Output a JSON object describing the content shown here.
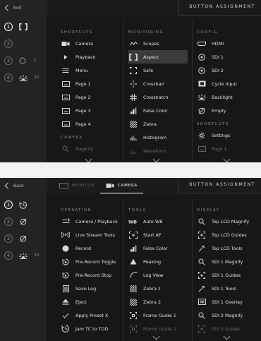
{
  "panel1": {
    "back_label": "Exit",
    "title": "BUTTON ASSIGNMENT",
    "slots": [
      {
        "number": "1",
        "label": "",
        "icon": "aspect-bracket-icon",
        "active": true
      },
      {
        "number": "2",
        "label": "",
        "icon": "",
        "active": false
      },
      {
        "number": "3",
        "label": "1",
        "icon": "lens-1-icon",
        "active": false
      },
      {
        "number": "4",
        "label": "20",
        "icon": "backlight-icon",
        "active": false
      }
    ],
    "columns": [
      {
        "sections": [
          {
            "title": "SHORTCUTS",
            "items": [
              {
                "label": "Camera",
                "icon": "camera-icon"
              },
              {
                "label": "Playback",
                "icon": "play-icon"
              },
              {
                "label": "Menu",
                "icon": "menu-icon"
              },
              {
                "label": "Page 1",
                "icon": "page-icon"
              },
              {
                "label": "Page 2",
                "icon": "page-icon"
              },
              {
                "label": "Page 3",
                "icon": "page-icon"
              },
              {
                "label": "Page 4",
                "icon": "page-icon"
              }
            ]
          },
          {
            "title": "CAMERA",
            "items": [
              {
                "label": "Magnify",
                "icon": "magnify-icon",
                "dim": true
              }
            ]
          }
        ]
      },
      {
        "sections": [
          {
            "title": "MONITORING",
            "items": [
              {
                "label": "Scopes",
                "icon": "scopes-icon"
              },
              {
                "label": "Aspect",
                "icon": "aspect-bracket-icon",
                "selected": true
              },
              {
                "label": "Safe",
                "icon": "safe-icon"
              },
              {
                "label": "Crosshair",
                "icon": "crosshair-icon"
              },
              {
                "label": "Crosshatch",
                "icon": "crosshatch-icon"
              },
              {
                "label": "False Color",
                "icon": "false-color-icon"
              },
              {
                "label": "Zebra",
                "icon": "zebra-icon"
              },
              {
                "label": "Histogram",
                "icon": "histogram-icon"
              },
              {
                "label": "Waveform",
                "icon": "waveform-icon",
                "dim": true
              }
            ]
          }
        ]
      },
      {
        "sections": [
          {
            "title": "CONFIG",
            "items": [
              {
                "label": "HDMI",
                "icon": "hdmi-icon"
              },
              {
                "label": "SDI 1",
                "icon": "sdi-icon"
              },
              {
                "label": "SDI 2",
                "icon": "sdi-icon"
              },
              {
                "label": "Cycle Input",
                "icon": "cycle-input-icon"
              },
              {
                "label": "Backlight",
                "icon": "backlight-icon"
              },
              {
                "label": "Empty",
                "icon": "empty-icon"
              }
            ]
          },
          {
            "title": "SHORTCUTS",
            "items": [
              {
                "label": "Settings",
                "icon": "gear-icon"
              },
              {
                "label": "Page 1",
                "icon": "page-icon",
                "dim": true
              }
            ]
          }
        ]
      }
    ]
  },
  "panel2": {
    "back_label": "Back",
    "title": "BUTTON ASSIGNMENT",
    "tabs": [
      {
        "label": "MONITOR",
        "icon": "monitor-icon",
        "active": false
      },
      {
        "label": "CAMERA",
        "icon": "camera-icon",
        "active": true
      }
    ],
    "slots": [
      {
        "number": "1",
        "label": "",
        "icon": "timecode-sync-icon",
        "active": true
      },
      {
        "number": "2",
        "label": "",
        "icon": "empty-icon",
        "active": false
      },
      {
        "number": "3",
        "label": "",
        "icon": "empty-icon",
        "active": false
      },
      {
        "number": "4",
        "label": "20",
        "icon": "backlight-icon",
        "active": false
      }
    ],
    "columns": [
      {
        "sections": [
          {
            "title": "OPERATION",
            "items": [
              {
                "label": "Camera / Playback",
                "icon": "camera-playback-icon"
              },
              {
                "label": "Live Stream Tools",
                "icon": "live-stream-icon"
              },
              {
                "label": "Record",
                "icon": "record-icon"
              },
              {
                "label": "Pre-Record Toggle",
                "icon": "pre-record-icon"
              },
              {
                "label": "Pre-Record Stop",
                "icon": "pre-record-stop-icon"
              },
              {
                "label": "Save Log",
                "icon": "save-log-icon"
              },
              {
                "label": "Eject",
                "icon": "eject-icon"
              },
              {
                "label": "Apply Preset X",
                "icon": "checkmark-icon"
              },
              {
                "label": "Jam TC to TOD",
                "icon": "timecode-sync-icon"
              }
            ]
          }
        ]
      },
      {
        "sections": [
          {
            "title": "TOOLS",
            "items": [
              {
                "label": "Auto WB",
                "icon": "auto-wb-icon"
              },
              {
                "label": "Start AF",
                "icon": "autofocus-icon"
              },
              {
                "label": "False Color",
                "icon": "false-color-icon"
              },
              {
                "label": "Peaking",
                "icon": "peaking-icon"
              },
              {
                "label": "Log View",
                "icon": "log-view-icon"
              },
              {
                "label": "Zebra 1",
                "icon": "zebra-icon"
              },
              {
                "label": "Zebra 2",
                "icon": "zebra-icon"
              },
              {
                "label": "Frame Guide 1",
                "icon": "frame-guide-icon"
              },
              {
                "label": "Frame Guide 2",
                "icon": "frame-guide-icon",
                "dim": true
              }
            ]
          }
        ]
      },
      {
        "sections": [
          {
            "title": "DISPLAY",
            "items": [
              {
                "label": "Top LCD Magnify",
                "icon": "magnify-icon"
              },
              {
                "label": "Top LCD Guides",
                "icon": "guides-icon"
              },
              {
                "label": "Top LCD Tools",
                "icon": "tools-icon"
              },
              {
                "label": "SDI 1 Magnify",
                "icon": "magnify-icon"
              },
              {
                "label": "SDI 1 Guides",
                "icon": "guides-icon"
              },
              {
                "label": "SDI 1 Tools",
                "icon": "tools-icon"
              },
              {
                "label": "SDI 1 Overlay",
                "icon": "overlay-icon"
              },
              {
                "label": "SDI 2 Magnify",
                "icon": "magnify-icon"
              },
              {
                "label": "SDI 2 Guides",
                "icon": "guides-icon",
                "dim": true
              }
            ]
          }
        ]
      }
    ]
  },
  "colors": {
    "panel_bg": "#171717",
    "sidebar_bg": "#232323",
    "selected_bg": "#3b3b3b",
    "text": "#e0e0e0",
    "section": "#8d8d8d"
  }
}
